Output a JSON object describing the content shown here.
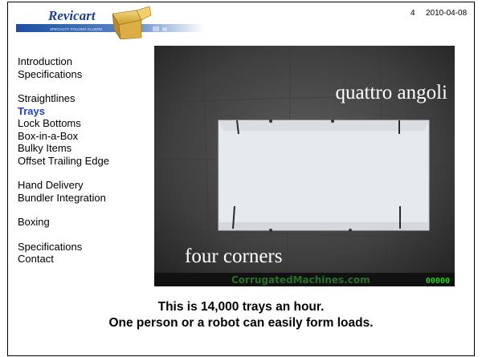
{
  "header": {
    "brand": "Revicart",
    "brand_tagline": "SPECIALTY FOLDING GLUERS",
    "page_number": "4",
    "date": "2010-04-08"
  },
  "nav": {
    "groups": [
      [
        {
          "label": "Introduction",
          "active": false
        },
        {
          "label": "Specifications",
          "active": false
        }
      ],
      [
        {
          "label": "Straightlines",
          "active": false
        },
        {
          "label": "Trays",
          "active": true
        },
        {
          "label": "Lock Bottoms",
          "active": false
        },
        {
          "label": "Box-in-a-Box",
          "active": false
        },
        {
          "label": "Bulky Items",
          "active": false
        },
        {
          "label": "Offset Trailing Edge",
          "active": false
        }
      ],
      [
        {
          "label": "Hand Delivery",
          "active": false
        },
        {
          "label": "Bundler Integration",
          "active": false
        }
      ],
      [
        {
          "label": "Boxing",
          "active": false
        }
      ],
      [
        {
          "label": "Specifications",
          "active": false
        },
        {
          "label": "Contact",
          "active": false
        }
      ]
    ],
    "active_color": "#1f3fd6"
  },
  "video": {
    "title_text": "quattro angoli",
    "subtitle_text": "four corners",
    "watermark": "CorrugatedMachines.com",
    "counter": "00000"
  },
  "captions": {
    "line1": "This is 14,000 trays an hour.",
    "line2": "One person or a robot can easily form loads."
  }
}
